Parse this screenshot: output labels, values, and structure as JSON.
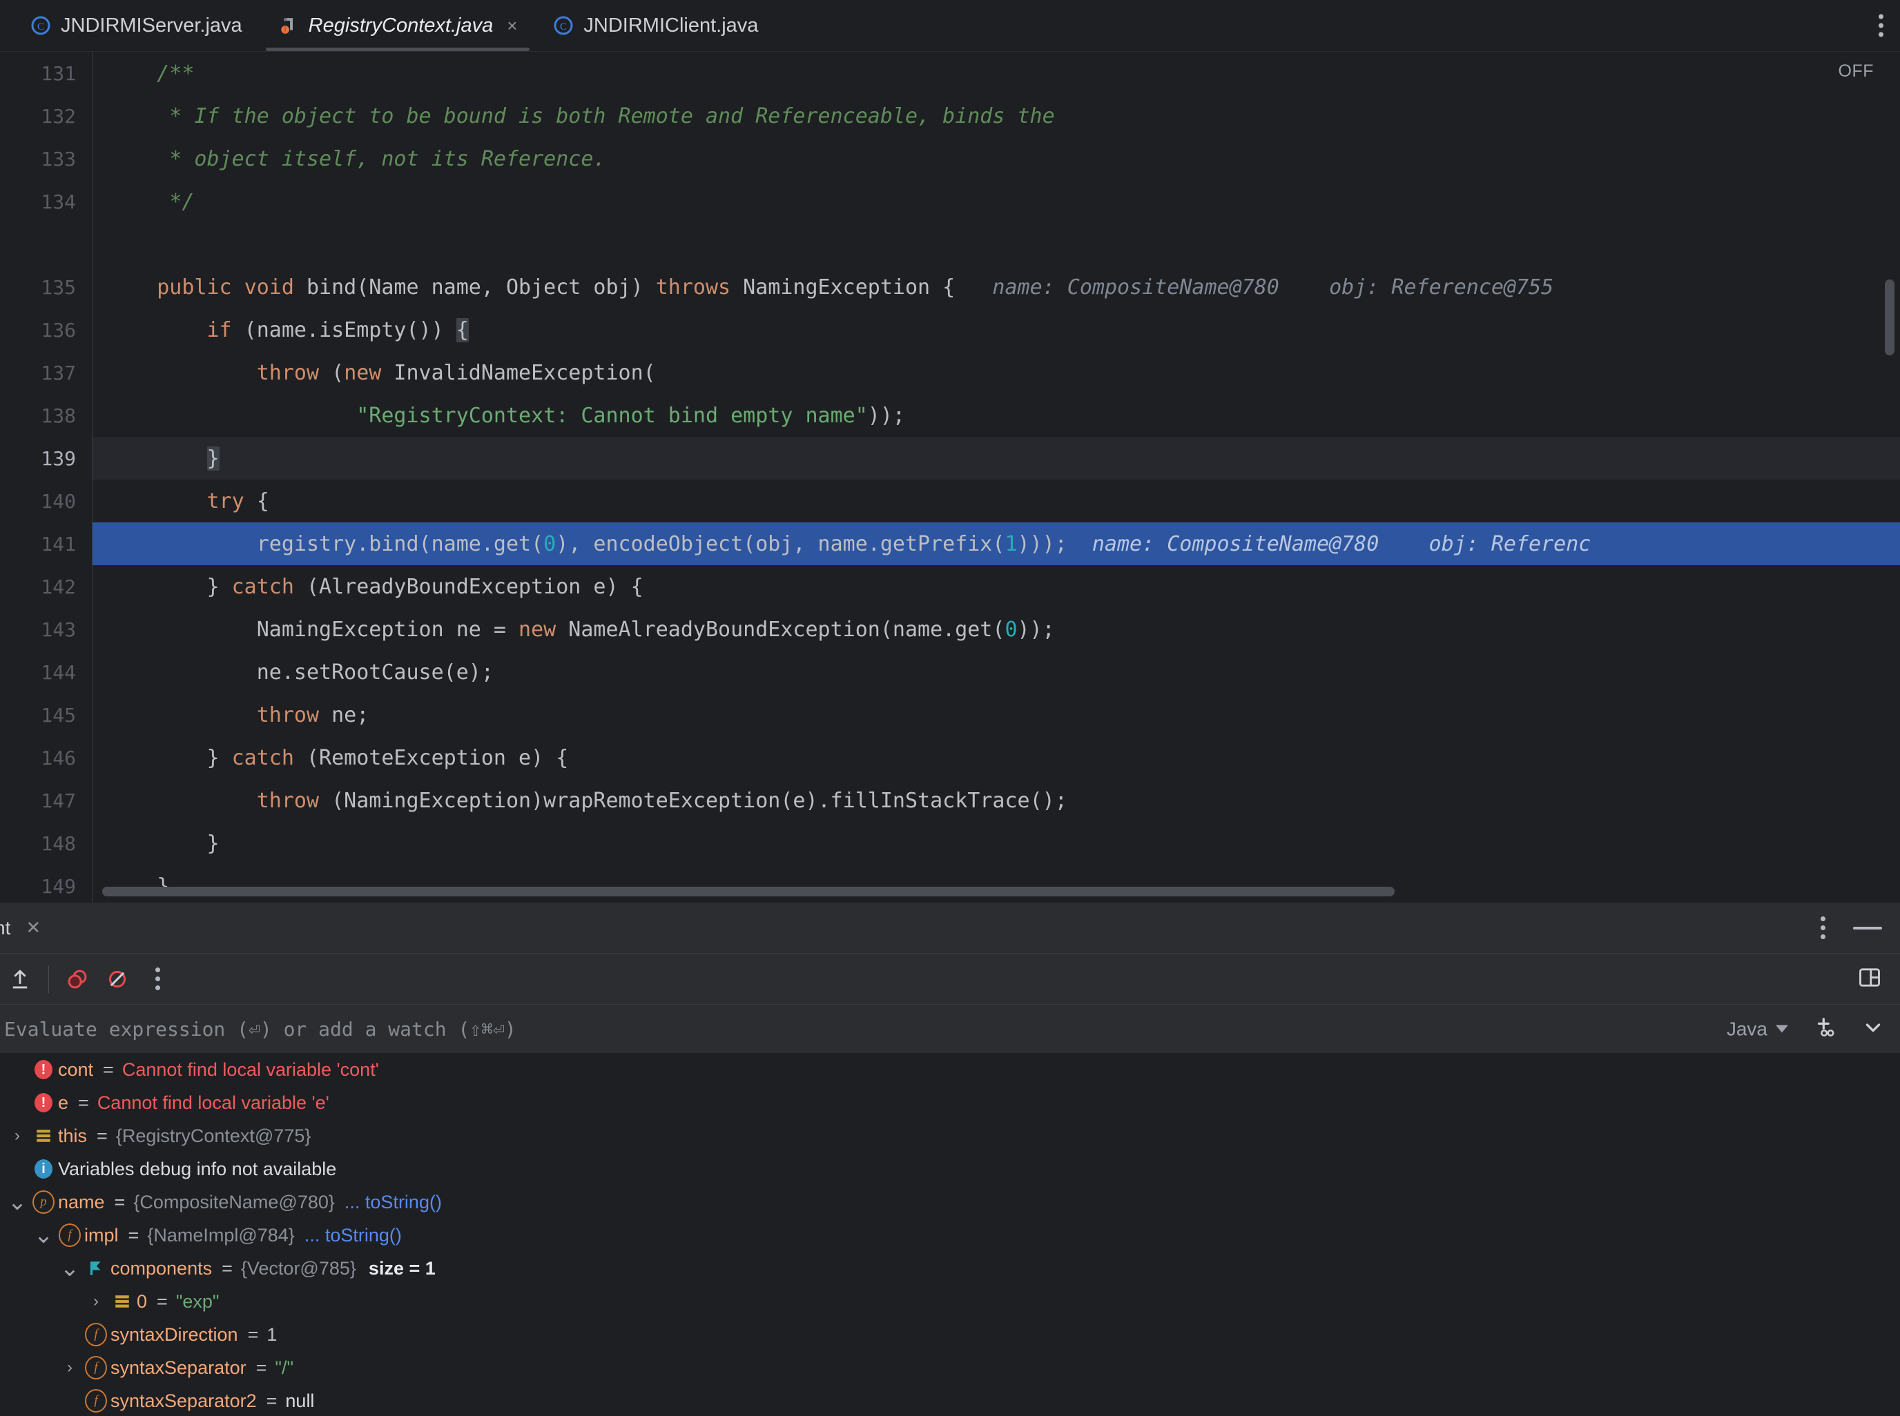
{
  "tabs": [
    {
      "label": "JNDIRMIServer.java",
      "icon": "java-class-icon",
      "active": false,
      "closable": false
    },
    {
      "label": "RegistryContext.java",
      "icon": "java-decompiled-class-icon",
      "active": true,
      "closable": true,
      "close_label": "×"
    },
    {
      "label": "JNDIRMIClient.java",
      "icon": "java-class-icon",
      "active": false,
      "closable": false
    }
  ],
  "editor": {
    "inspections_widget": "OFF",
    "lines": [
      {
        "no": "131",
        "tokens": [
          {
            "t": "    ",
            "c": "txt"
          },
          {
            "t": "/**",
            "c": "cmt"
          }
        ]
      },
      {
        "no": "132",
        "tokens": [
          {
            "t": "     ",
            "c": "txt"
          },
          {
            "t": "* If the object to be bound is both Remote and Referenceable, binds the",
            "c": "cmt"
          }
        ]
      },
      {
        "no": "133",
        "tokens": [
          {
            "t": "     ",
            "c": "txt"
          },
          {
            "t": "* object itself, not its Reference.",
            "c": "cmt"
          }
        ]
      },
      {
        "no": "134",
        "tokens": [
          {
            "t": "     ",
            "c": "txt"
          },
          {
            "t": "*/",
            "c": "cmt"
          }
        ]
      },
      {
        "no": "",
        "tokens": []
      },
      {
        "no": "135",
        "tokens": [
          {
            "t": "    ",
            "c": "txt"
          },
          {
            "t": "public",
            "c": "kw"
          },
          {
            "t": " ",
            "c": "txt"
          },
          {
            "t": "void",
            "c": "kw"
          },
          {
            "t": " bind(Name name, Object obj) ",
            "c": "txt"
          },
          {
            "t": "throws",
            "c": "kw"
          },
          {
            "t": " NamingException {",
            "c": "txt"
          },
          {
            "t": "   name: CompositeName@780",
            "c": "hint"
          },
          {
            "t": "    obj: Reference@755",
            "c": "hint"
          }
        ]
      },
      {
        "no": "136",
        "tokens": [
          {
            "t": "        ",
            "c": "txt"
          },
          {
            "t": "if",
            "c": "kw"
          },
          {
            "t": " (name.isEmpty()) ",
            "c": "txt"
          },
          {
            "t": "{",
            "c": "brace-match"
          }
        ]
      },
      {
        "no": "137",
        "tokens": [
          {
            "t": "            ",
            "c": "txt"
          },
          {
            "t": "throw",
            "c": "kw"
          },
          {
            "t": " (",
            "c": "txt"
          },
          {
            "t": "new",
            "c": "kw"
          },
          {
            "t": " InvalidNameException(",
            "c": "txt"
          }
        ]
      },
      {
        "no": "138",
        "tokens": [
          {
            "t": "                    ",
            "c": "txt"
          },
          {
            "t": "\"RegistryContext: Cannot bind empty name\"",
            "c": "str"
          },
          {
            "t": "));",
            "c": "txt"
          }
        ]
      },
      {
        "no": "139",
        "caret": true,
        "tokens": [
          {
            "t": "        ",
            "c": "txt"
          },
          {
            "t": "}",
            "c": "brace-match"
          }
        ]
      },
      {
        "no": "140",
        "tokens": [
          {
            "t": "        ",
            "c": "txt"
          },
          {
            "t": "try",
            "c": "kw"
          },
          {
            "t": " {",
            "c": "txt"
          }
        ]
      },
      {
        "no": "141",
        "exec": true,
        "tokens": [
          {
            "t": "            registry.bind(name.get(",
            "c": "txt"
          },
          {
            "t": "0",
            "c": "num"
          },
          {
            "t": "), encodeObject(obj, name.getPrefix(",
            "c": "txt"
          },
          {
            "t": "1",
            "c": "num"
          },
          {
            "t": ")));",
            "c": "txt"
          },
          {
            "t": "  name: CompositeName@780",
            "c": "hint"
          },
          {
            "t": "    obj: Referenc",
            "c": "hint"
          }
        ]
      },
      {
        "no": "142",
        "tokens": [
          {
            "t": "        } ",
            "c": "txt"
          },
          {
            "t": "catch",
            "c": "kw"
          },
          {
            "t": " (AlreadyBoundException e) {",
            "c": "txt"
          }
        ]
      },
      {
        "no": "143",
        "tokens": [
          {
            "t": "            NamingException ne = ",
            "c": "txt"
          },
          {
            "t": "new",
            "c": "kw"
          },
          {
            "t": " NameAlreadyBoundException(name.get(",
            "c": "txt"
          },
          {
            "t": "0",
            "c": "num"
          },
          {
            "t": "));",
            "c": "txt"
          }
        ]
      },
      {
        "no": "144",
        "tokens": [
          {
            "t": "            ne.setRootCause(e);",
            "c": "txt"
          }
        ]
      },
      {
        "no": "145",
        "tokens": [
          {
            "t": "            ",
            "c": "txt"
          },
          {
            "t": "throw",
            "c": "kw"
          },
          {
            "t": " ne;",
            "c": "txt"
          }
        ]
      },
      {
        "no": "146",
        "tokens": [
          {
            "t": "        } ",
            "c": "txt"
          },
          {
            "t": "catch",
            "c": "kw"
          },
          {
            "t": " (RemoteException e) {",
            "c": "txt"
          }
        ]
      },
      {
        "no": "147",
        "tokens": [
          {
            "t": "            ",
            "c": "txt"
          },
          {
            "t": "throw",
            "c": "kw"
          },
          {
            "t": " (NamingException)wrapRemoteException(e).fillInStackTrace();",
            "c": "txt"
          }
        ]
      },
      {
        "no": "148",
        "tokens": [
          {
            "t": "        }",
            "c": "txt"
          }
        ]
      },
      {
        "no": "149",
        "tokens": [
          {
            "t": "    }",
            "c": "txt"
          }
        ]
      }
    ]
  },
  "debug_panel": {
    "title": "nt",
    "title_close": "✕",
    "toolbar": {
      "step_out": "step-out",
      "view_breakpoints": "view-breakpoints",
      "mute_breakpoints": "mute-breakpoints",
      "more": "more-options",
      "layout": "layout-settings"
    },
    "evaluate": {
      "placeholder": "Evaluate expression (⏎) or add a watch (⇧⌘⏎)",
      "language": "Java",
      "add_watch": "add-watch",
      "expand": "expand"
    },
    "variables": [
      {
        "indent": 0,
        "arrow": "none",
        "icon": "error-badge",
        "name": "cont",
        "eq": "=",
        "value": "Cannot find local variable 'cont'",
        "value_kind": "err"
      },
      {
        "indent": 0,
        "arrow": "none",
        "icon": "error-badge",
        "name": "e",
        "eq": "=",
        "value": "Cannot find local variable 'e'",
        "value_kind": "err"
      },
      {
        "indent": 0,
        "arrow": "collapsed",
        "icon": "stack-icon",
        "name": "this",
        "eq": "=",
        "value": "{RegistryContext@775}",
        "value_kind": "ref"
      },
      {
        "indent": 0,
        "arrow": "none",
        "icon": "info-badge",
        "name": "",
        "eq": "",
        "value": "Variables debug info not available",
        "value_kind": "plain"
      },
      {
        "indent": 0,
        "arrow": "expanded",
        "icon": "param-icon",
        "name": "name",
        "eq": "=",
        "value": "{CompositeName@780}",
        "value_kind": "ref",
        "link": "... toString()"
      },
      {
        "indent": 1,
        "arrow": "expanded",
        "icon": "field-icon",
        "name": "impl",
        "eq": "=",
        "value": "{NameImpl@784}",
        "value_kind": "ref",
        "link": "... toString()"
      },
      {
        "indent": 2,
        "arrow": "expanded",
        "icon": "array-flag-icon",
        "name": "components",
        "eq": "=",
        "value": "{Vector@785}",
        "value_kind": "ref",
        "extra": "size = 1"
      },
      {
        "indent": 3,
        "arrow": "collapsed",
        "icon": "stack-icon",
        "name": "0",
        "eq": "=",
        "value": "\"exp\"",
        "value_kind": "str"
      },
      {
        "indent": 2,
        "arrow": "none",
        "icon": "field-icon",
        "name": "syntaxDirection",
        "eq": "=",
        "value": "1",
        "value_kind": "num"
      },
      {
        "indent": 2,
        "arrow": "collapsed",
        "icon": "field-icon",
        "name": "syntaxSeparator",
        "eq": "=",
        "value": "\"/\"",
        "value_kind": "str"
      },
      {
        "indent": 2,
        "arrow": "none",
        "icon": "field-icon",
        "name": "syntaxSeparator2",
        "eq": "=",
        "value": "null",
        "value_kind": "plain"
      }
    ]
  },
  "colors": {
    "editor_bg": "#1E1F22",
    "panel_bg": "#2B2D30",
    "exec_highlight": "#2D55A0",
    "keyword": "#CF8E6D",
    "string": "#6AAB73",
    "comment": "#5F8C5A",
    "number": "#2AACB8",
    "error": "#F05C5C",
    "link": "#548AF7",
    "var_name": "#F5A97A"
  }
}
